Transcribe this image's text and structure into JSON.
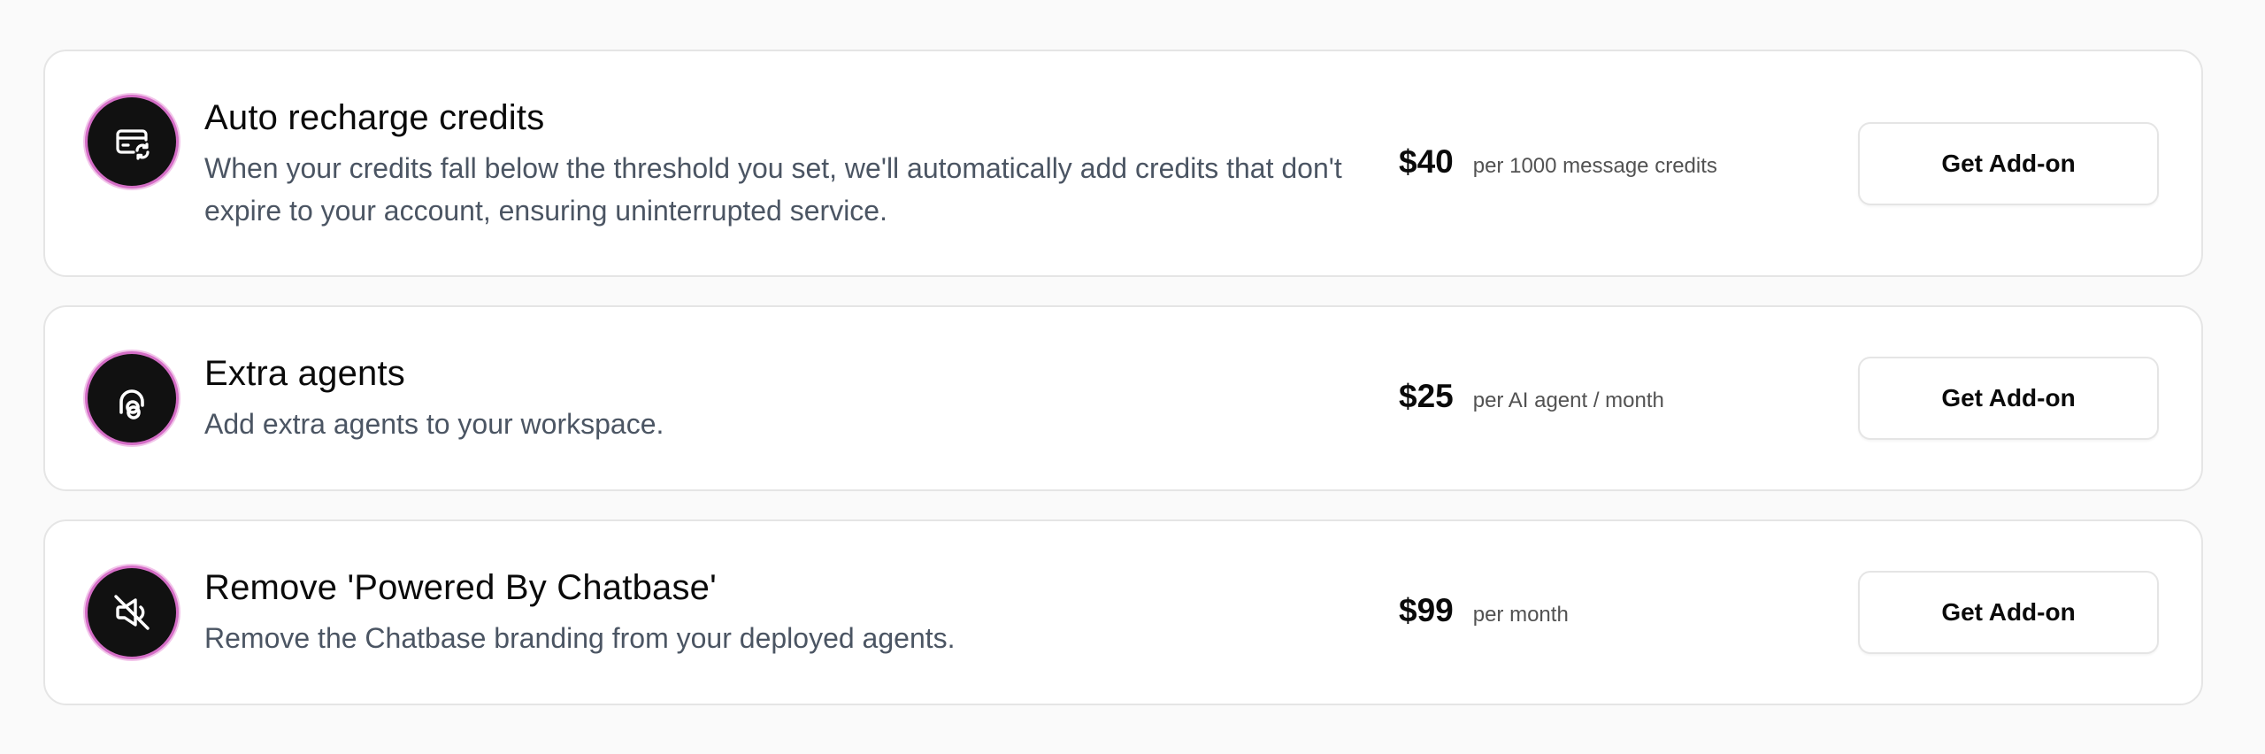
{
  "addons": [
    {
      "title": "Auto recharge credits",
      "description": "When your credits fall below the threshold you set, we'll automatically add credits that don't expire to your account, ensuring uninterrupted service.",
      "price": "$40",
      "price_unit": "per 1000 message credits",
      "button_label": "Get Add-on",
      "icon": "credit-card-refresh-icon"
    },
    {
      "title": "Extra agents",
      "description": "Add extra agents to your workspace.",
      "price": "$25",
      "price_unit": "per AI agent / month",
      "button_label": "Get Add-on",
      "icon": "agent-icon"
    },
    {
      "title": "Remove 'Powered By Chatbase'",
      "description": "Remove the Chatbase branding from your deployed agents.",
      "price": "$99",
      "price_unit": "per month",
      "button_label": "Get Add-on",
      "icon": "megaphone-off-icon"
    }
  ],
  "colors": {
    "icon_background": "#111111",
    "icon_ring": "#d46ec6",
    "card_border": "#e5e5e5",
    "page_background": "#fafafa"
  }
}
